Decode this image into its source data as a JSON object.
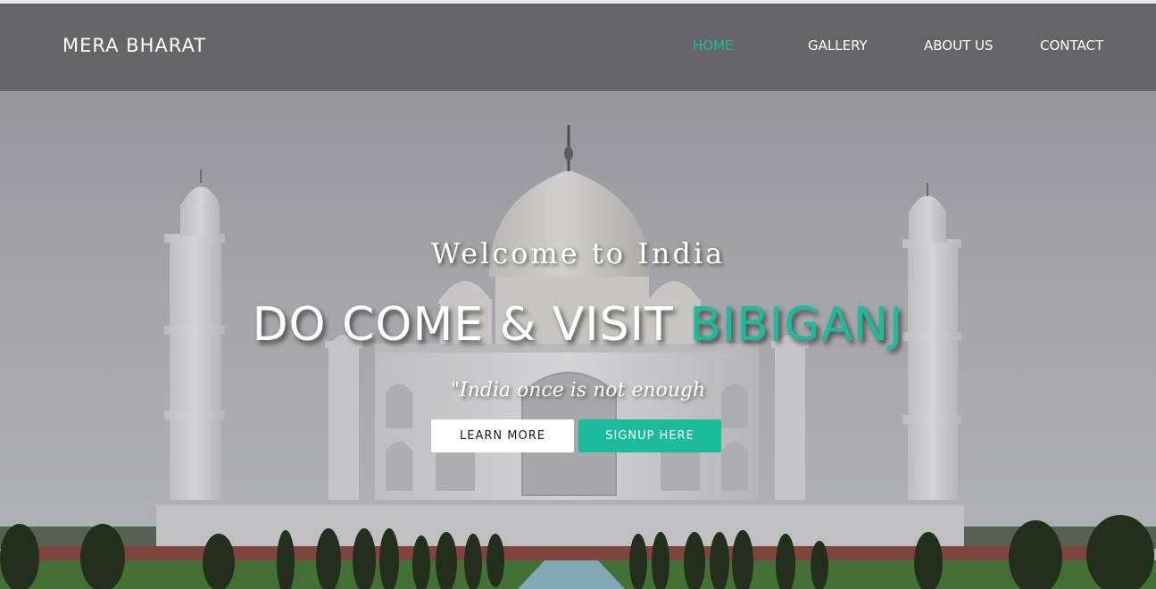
{
  "colors": {
    "accent": "#1bbc9b",
    "navbar_bg": "#58585c",
    "text_light": "#ffffff"
  },
  "navbar": {
    "brand": "MERA BHARAT",
    "links": [
      {
        "label": "HOME",
        "active": true
      },
      {
        "label": "GALLERY",
        "active": false
      },
      {
        "label": "ABOUT US",
        "active": false
      },
      {
        "label": "CONTACT",
        "active": false
      }
    ]
  },
  "hero": {
    "welcome": "Welcome to India",
    "headline_prefix": "DO COME & VISIT",
    "headline_highlight": "BIBIGANJ",
    "tagline": "\"India once is not enough",
    "buttons": {
      "learn_more": "LEARN MORE",
      "signup": "SIGNUP HERE"
    }
  }
}
